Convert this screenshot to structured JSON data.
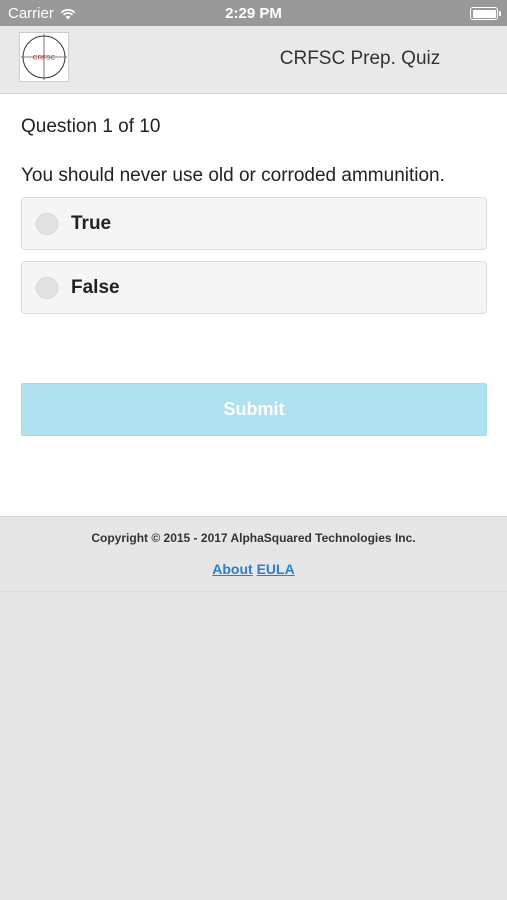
{
  "status_bar": {
    "carrier": "Carrier",
    "time": "2:29 PM",
    "battery_level": 1.0
  },
  "header": {
    "logo_text": "CRFSC",
    "title": "CRFSC Prep. Quiz"
  },
  "quiz": {
    "progress": "Question 1 of 10",
    "question": "You should never use old or corroded ammunition.",
    "options": [
      {
        "label": "True",
        "selected": false
      },
      {
        "label": "False",
        "selected": false
      }
    ],
    "submit_label": "Submit"
  },
  "footer": {
    "copyright": "Copyright © 2015 - 2017 AlphaSquared Technologies Inc.",
    "about_label": "About",
    "eula_label": "EULA"
  },
  "colors": {
    "submit_bg": "#b0e1ef",
    "link": "#2d7fc6",
    "logo_red": "#cc2222"
  }
}
